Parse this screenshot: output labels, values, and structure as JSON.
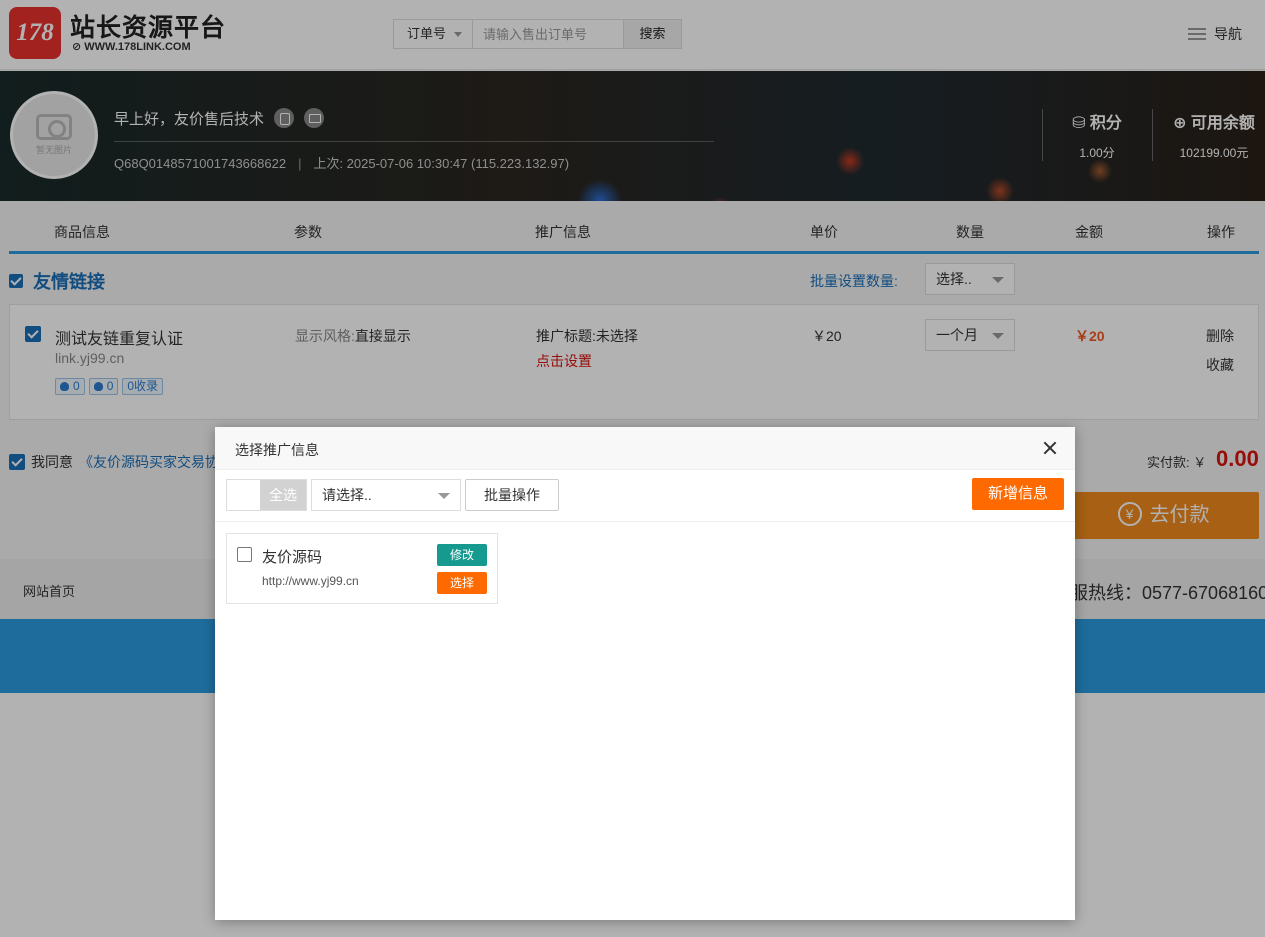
{
  "header": {
    "logo_text": "178",
    "site_title": "站长资源平台",
    "site_url": "WWW.178LINK.COM",
    "search_type": "订单号",
    "search_placeholder": "请输入售出订单号",
    "search_button": "搜索",
    "nav_label": "导航"
  },
  "profile": {
    "avatar_text": "暂无图片",
    "greeting": "早上好，友价售后技术",
    "user_id": "Q68Q0148571001743668622",
    "last_login": "上次: 2025-07-06 10:30:47 (115.223.132.97)",
    "points_label": "积分",
    "points_value": "1.00分",
    "balance_label": "可用余额",
    "balance_value": "102199.00元"
  },
  "cart": {
    "columns": [
      "商品信息",
      "参数",
      "推广信息",
      "单价",
      "数量",
      "金额",
      "操作"
    ],
    "group_title": "友情链接",
    "batch_label": "批量设置数量:",
    "batch_select": "选择..",
    "item": {
      "name": "测试友链重复认证",
      "url": "link.yj99.cn",
      "tag1": "0",
      "tag2": "0",
      "tag3": "0收录",
      "style_label": "显示风格:",
      "style_value": "直接显示",
      "promo_label": "推广标题:",
      "promo_value": "未选择",
      "promo_link": "点击设置",
      "price": "￥20",
      "duration": "一个月",
      "amount": "￥20",
      "delete": "删除",
      "favorite": "收藏"
    },
    "agree_prefix": "我同意",
    "agree_link": "《友价源码买家交易协",
    "pay_label": "实付款:",
    "pay_currency": "￥",
    "pay_amount": "0.00",
    "pay_button": "去付款",
    "pay_icon": "¥"
  },
  "footer": {
    "home": "网站首页",
    "hotline": "服热线：0577-67068160"
  },
  "modal": {
    "title": "选择推广信息",
    "select_all": "全选",
    "select_placeholder": "请选择..",
    "batch_button": "批量操作",
    "new_button": "新增信息",
    "entry": {
      "name": "友价源码",
      "url": "http://www.yj99.cn",
      "edit": "修改",
      "choose": "选择"
    }
  }
}
